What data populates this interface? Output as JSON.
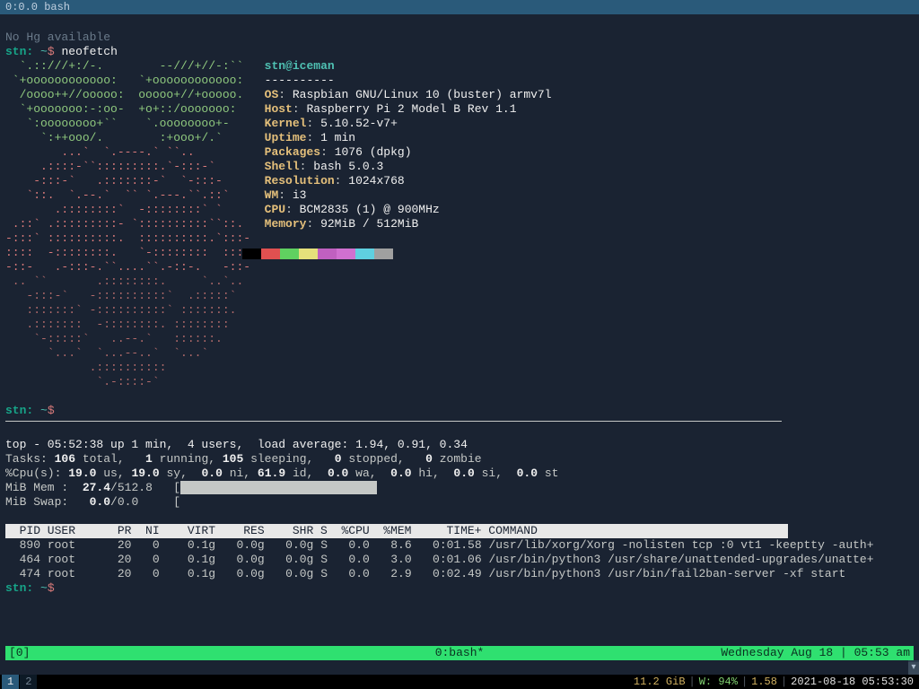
{
  "titlebar": "0:0.0 bash",
  "hg_msg": "No Hg available",
  "prompt": {
    "user_host": "stn:",
    "path": "~",
    "symbol": "$"
  },
  "cmd_neofetch": "neofetch",
  "neofetch": {
    "userhost": "stn@iceman",
    "dashes": "----------",
    "rows": [
      {
        "label": "OS",
        "value": "Raspbian GNU/Linux 10 (buster) armv7l"
      },
      {
        "label": "Host",
        "value": "Raspberry Pi 2 Model B Rev 1.1"
      },
      {
        "label": "Kernel",
        "value": "5.10.52-v7+"
      },
      {
        "label": "Uptime",
        "value": "1 min"
      },
      {
        "label": "Packages",
        "value": "1076 (dpkg)"
      },
      {
        "label": "Shell",
        "value": "bash 5.0.3"
      },
      {
        "label": "Resolution",
        "value": "1024x768"
      },
      {
        "label": "WM",
        "value": "i3"
      },
      {
        "label": "CPU",
        "value": "BCM2835 (1) @ 900MHz"
      },
      {
        "label": "Memory",
        "value": "92MiB / 512MiB"
      }
    ],
    "swatches": [
      "#000000",
      "#e05050",
      "#60d060",
      "#e5e07b",
      "#c060c0",
      "#d070d0",
      "#5fd0e0",
      "#a0a0a0"
    ]
  },
  "ascii": {
    "green": [
      "  `.::///+:/-.        --///+//-:``   ",
      " `+oooooooooooo:   `+oooooooooooo:   ",
      "  /oooo++//ooooo:  ooooo+//+ooooo.   ",
      "  `+ooooooo:-:oo-  +o+::/ooooooo:    ",
      "   `:oooooooo+``    `.oooooooo+-     ",
      "     `:++ooo/.        :+ooo+/.`      "
    ],
    "red": [
      "        ...`  `.----.` ``..          ",
      "     .::::-``:::::::::.`-:::-`       ",
      "    -:::-`   .:::::::-`  `-:::-      ",
      "   `::.  `.--.`  `` `.---.``.::`     ",
      "       .::::::::`  -::::::::` `      ",
      " .::` .:::::::::- `::::::::::``::.   ",
      "-:::` ::::::::::.  ::::::::::.`:::-  ",
      "::::  -::::::::.   `-::::::::  ::::  ",
      "-::-   .-:::-.``....``.-::-.   -::-  ",
      " .. ``       .::::::::.     `..`..   ",
      "   -:::-`   -::::::::::`  .:::::`    ",
      "   :::::::` -::::::::::` :::::::.    ",
      "   .:::::::  -::::::::. ::::::::     ",
      "    `-:::::`   ..--.`   ::::::.      ",
      "      `...`  `...--..`  `...`        ",
      "            .::::::::::              ",
      "             `.-::::-`               "
    ]
  },
  "top": {
    "line1_a": "top - 05:52:38 up 1 min,  4 users,  load average: 1.94, 0.91, 0.34",
    "tasks": {
      "label": "Tasks:",
      "total": "106",
      "running": "1",
      "sleeping": "105",
      "stopped": "0",
      "zombie": "0"
    },
    "cpu": {
      "label": "%Cpu(s):",
      "us": "19.0",
      "sy": "19.0",
      "ni": "0.0",
      "id": "61.9",
      "wa": "0.0",
      "hi": "0.0",
      "si": "0.0",
      "st": "0.0"
    },
    "mem": {
      "label": "MiB Mem :",
      "used": "27.4",
      "total": "512.8"
    },
    "swap": {
      "label": "MiB Swap:",
      "used": "0.0",
      "total": "0.0"
    },
    "header": "  PID USER      PR  NI    VIRT    RES    SHR S  %CPU  %MEM     TIME+ COMMAND                                                 ",
    "rows": [
      {
        "pid": "890",
        "user": "root",
        "pr": "20",
        "ni": "0",
        "virt": "0.1g",
        "res": "0.0g",
        "shr": "0.0g",
        "s": "S",
        "cpu": "0.0",
        "mem": "8.6",
        "time": "0:01.58",
        "cmd": "/usr/lib/xorg/Xorg -nolisten tcp :0 vt1 -keeptty -auth+"
      },
      {
        "pid": "464",
        "user": "root",
        "pr": "20",
        "ni": "0",
        "virt": "0.1g",
        "res": "0.0g",
        "shr": "0.0g",
        "s": "S",
        "cpu": "0.0",
        "mem": "3.0",
        "time": "0:01.06",
        "cmd": "/usr/bin/python3 /usr/share/unattended-upgrades/unatte+"
      },
      {
        "pid": "474",
        "user": "root",
        "pr": "20",
        "ni": "0",
        "virt": "0.1g",
        "res": "0.0g",
        "shr": "0.0g",
        "s": "S",
        "cpu": "0.0",
        "mem": "2.9",
        "time": "0:02.49",
        "cmd": "/usr/bin/python3 /usr/bin/fail2ban-server -xf start"
      }
    ]
  },
  "tmux": {
    "left": "[0]",
    "center": "0:bash*",
    "right": "Wednesday Aug 18 | 05:53 am"
  },
  "i3": {
    "ws": [
      "1",
      "2"
    ],
    "disk": "11.2 GiB",
    "wlabel": "W:",
    "wifi": "94%",
    "load": "1.58",
    "time": "2021-08-18 05:53:30"
  }
}
